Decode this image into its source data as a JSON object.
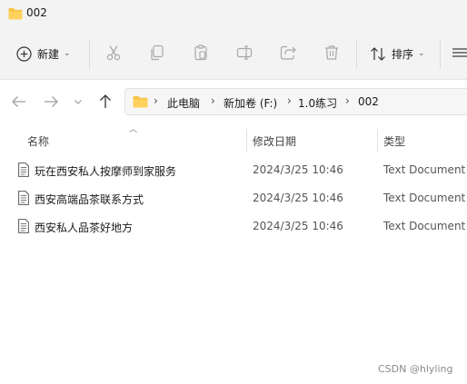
{
  "window": {
    "title": "002"
  },
  "toolbar": {
    "new_label": "新建",
    "sort_label": "排序",
    "icons": [
      "cut-icon",
      "copy-icon",
      "paste-icon",
      "rename-icon",
      "share-icon",
      "delete-icon"
    ]
  },
  "breadcrumb": {
    "items": [
      "此电脑",
      "新加卷 (F:)",
      "1.0练习",
      "002"
    ],
    "separator": "›"
  },
  "columns": {
    "name": "名称",
    "modified": "修改日期",
    "type": "类型"
  },
  "files": [
    {
      "name": "玩在西安私人按摩师到家服务",
      "modified": "2024/3/25 10:46",
      "type": "Text Document"
    },
    {
      "name": "西安高端品茶联系方式",
      "modified": "2024/3/25 10:46",
      "type": "Text Document"
    },
    {
      "name": "西安私人品茶好地方",
      "modified": "2024/3/25 10:46",
      "type": "Text Document"
    }
  ],
  "watermark": "CSDN @hlyling",
  "colors": {
    "folder": "#f6c344",
    "chrome": "#f3f3f3",
    "accent": "#0067c0"
  }
}
